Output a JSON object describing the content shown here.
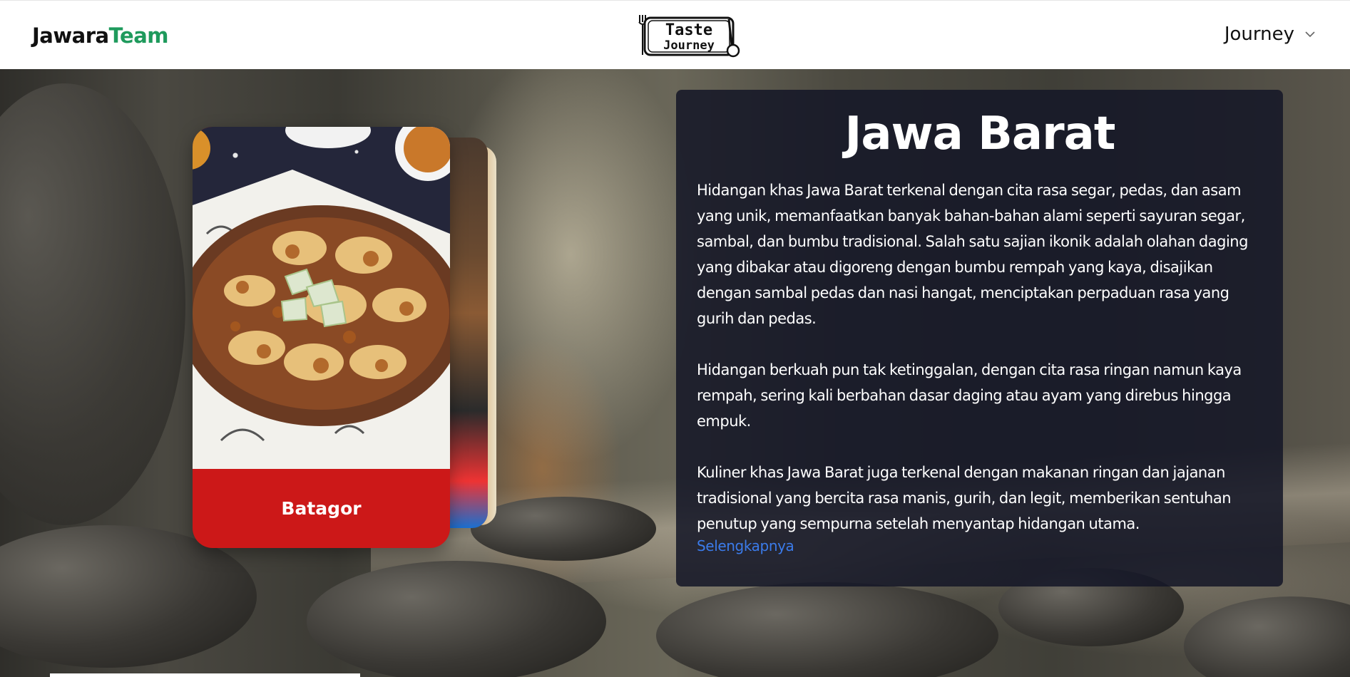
{
  "header": {
    "brand_primary": "Jawara",
    "brand_accent": "Team",
    "logo_text_top": "Taste",
    "logo_text_bottom": "Journey",
    "nav_label": "Journey",
    "nav_icon": "chevron-down-icon"
  },
  "card": {
    "name": "Batagor",
    "label_color": "#cc1818"
  },
  "panel": {
    "title": "Jawa Barat",
    "paragraphs": [
      "Hidangan khas Jawa Barat terkenal dengan cita rasa segar, pedas, dan asam yang unik, memanfaatkan banyak bahan-bahan alami seperti sayuran segar, sambal, dan bumbu tradisional. Salah satu sajian ikonik adalah olahan daging yang dibakar atau digoreng dengan bumbu rempah yang kaya, disajikan dengan sambal pedas dan nasi hangat, menciptakan perpaduan rasa yang gurih dan pedas.",
      "Hidangan berkuah pun tak ketinggalan, dengan cita rasa ringan namun kaya rempah, sering kali berbahan dasar daging atau ayam yang direbus hingga empuk.",
      "Kuliner khas Jawa Barat juga terkenal dengan makanan ringan dan jajanan tradisional yang bercita rasa manis, gurih, dan legit, memberikan sentuhan penutup yang sempurna setelah menyantap hidangan utama."
    ],
    "link_label": "Selengkapnya"
  },
  "colors": {
    "brand_accent": "#1e9a5c",
    "card_label_bg": "#cc1818",
    "panel_bg": "#141626",
    "link": "#3b7bea"
  }
}
